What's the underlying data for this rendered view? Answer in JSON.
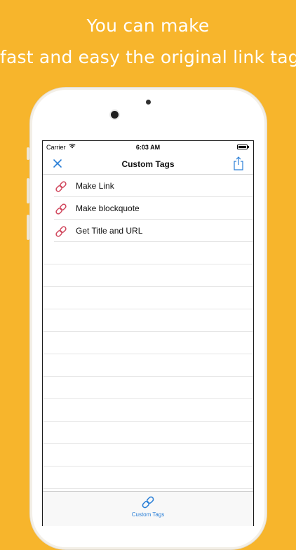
{
  "headline": {
    "line1": "You can make",
    "line2": "fast and easy the original link tag."
  },
  "status_bar": {
    "carrier": "Carrier",
    "time": "6:03 AM"
  },
  "nav": {
    "title": "Custom Tags",
    "left_icon": "close-icon",
    "right_icon": "share-icon"
  },
  "list": {
    "items": [
      {
        "label": "Make Link",
        "icon": "link-icon"
      },
      {
        "label": "Make blockquote",
        "icon": "link-icon"
      },
      {
        "label": "Get Title and URL",
        "icon": "link-icon"
      }
    ]
  },
  "tabbar": {
    "tab_label": "Custom Tags",
    "tab_icon": "link-icon"
  },
  "colors": {
    "background": "#F7B52C",
    "accent_blue": "#2A7FD7",
    "link_icon_red": "#D0455B"
  }
}
